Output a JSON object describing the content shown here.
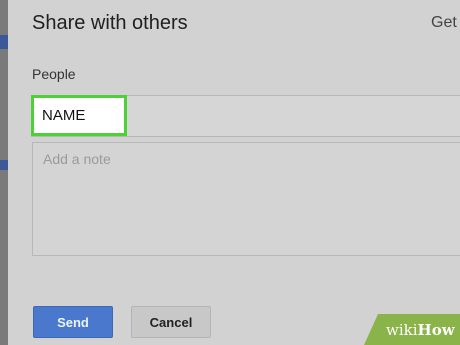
{
  "dialog": {
    "title": "Share with others",
    "get_link_label": "Get",
    "people_label": "People",
    "people_value": "NAME",
    "note_placeholder": "Add a note",
    "send_label": "Send",
    "cancel_label": "Cancel"
  },
  "colors": {
    "highlight_border": "#4cd137",
    "send_button": "#4a78cc"
  },
  "watermark": {
    "prefix": "wiki",
    "suffix": "How"
  }
}
